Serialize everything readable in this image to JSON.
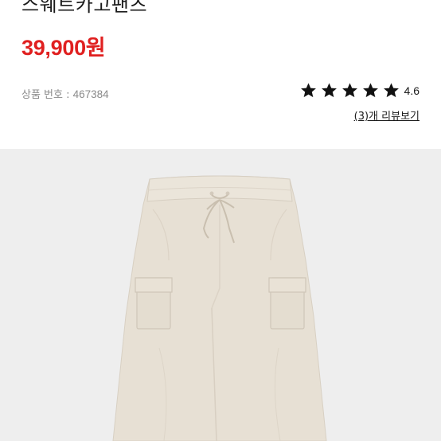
{
  "product": {
    "title": "스웨트카고팬츠",
    "price": "39,900원",
    "product_number_label": "상품 번호 : ",
    "product_number": "467384"
  },
  "rating": {
    "stars": 5,
    "value": "4.6",
    "reviews_link": "(3)개 리뷰보기"
  },
  "image": {
    "subject": "sweat cargo pants",
    "background_color": "#eeeeee",
    "fabric_color": "#e7e0d4"
  }
}
